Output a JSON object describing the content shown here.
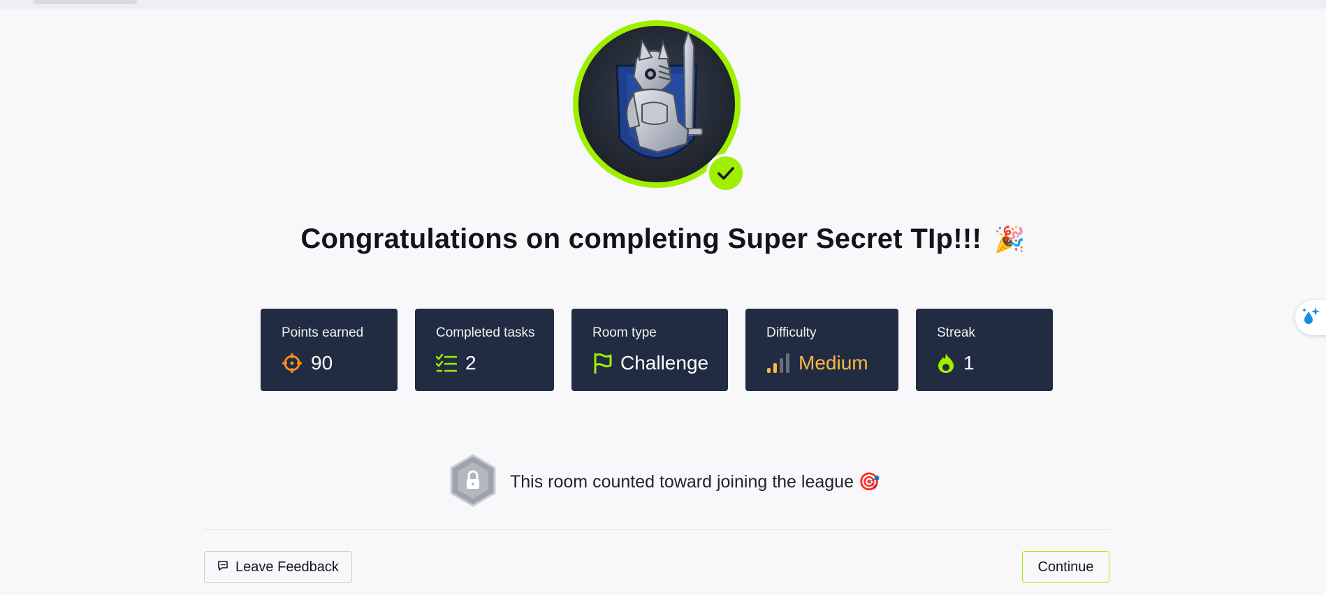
{
  "title": {
    "text": "Congratulations on completing Super Secret TIp!!!",
    "emoji": "🎉"
  },
  "stats": [
    {
      "label": "Points earned",
      "value": "90",
      "icon": "target-icon"
    },
    {
      "label": "Completed tasks",
      "value": "2",
      "icon": "checklist-icon"
    },
    {
      "label": "Room type",
      "value": "Challenge",
      "icon": "flag-icon"
    },
    {
      "label": "Difficulty",
      "value": "Medium",
      "icon": "signal-bars-icon"
    },
    {
      "label": "Streak",
      "value": "1",
      "icon": "flame-icon"
    }
  ],
  "league": {
    "text": "This room counted toward joining the league",
    "emoji": "🎯",
    "icon": "lock-hexagon-icon"
  },
  "buttons": {
    "feedback": "Leave Feedback",
    "continue": "Continue"
  },
  "colors": {
    "accent": "#9fef00",
    "card_bg": "#212c42",
    "points_icon": "#ff8c1a",
    "difficulty": "#ffb83f"
  }
}
